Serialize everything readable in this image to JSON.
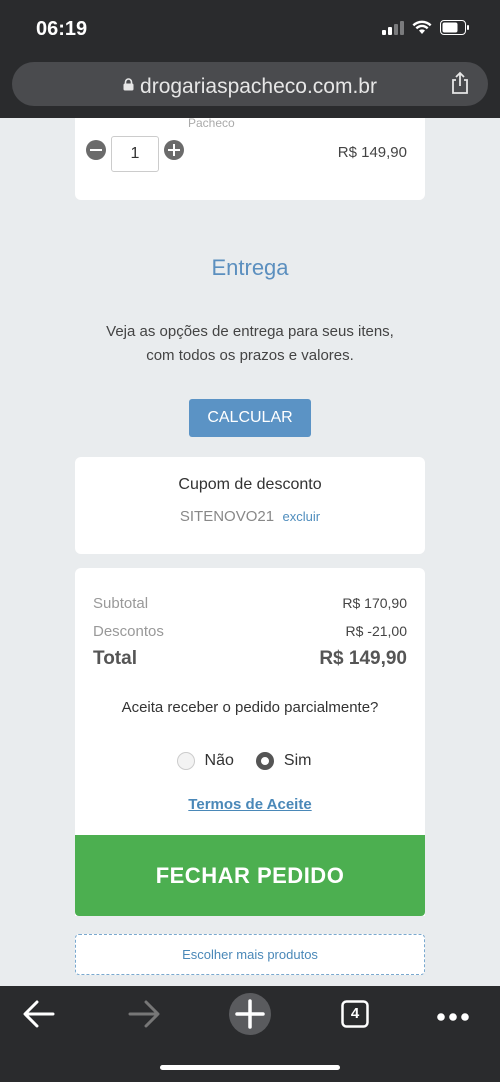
{
  "status_bar": {
    "time": "06:19"
  },
  "browser": {
    "url": "drogariaspacheco.com.br"
  },
  "product": {
    "brand": "Pacheco",
    "quantity": "1",
    "price": "R$ 149,90"
  },
  "delivery": {
    "title": "Entrega",
    "text_line1": "Veja as opções de entrega para seus itens,",
    "text_line2": "com todos os prazos e valores.",
    "calc_button": "CALCULAR"
  },
  "coupon": {
    "title": "Cupom de desconto",
    "code": "SITENOVO21",
    "remove_label": "excluir"
  },
  "summary": {
    "subtotal_label": "Subtotal",
    "subtotal_value": "R$ 170,90",
    "discount_label": "Descontos",
    "discount_value": "R$ -21,00",
    "total_label": "Total",
    "total_value": "R$ 149,90"
  },
  "partial": {
    "question": "Aceita receber o pedido parcialmente?",
    "option_no": "Não",
    "option_yes": "Sim",
    "selected": "Sim",
    "terms_link": "Termos de Aceite"
  },
  "actions": {
    "checkout": "FECHAR PEDIDO",
    "more_products": "Escolher mais produtos"
  },
  "toolbar": {
    "tabs_count": "4"
  },
  "colors": {
    "accent_blue": "#5b93c5",
    "checkout_green": "#4caf50",
    "chrome_dark": "#2a2b2d"
  }
}
